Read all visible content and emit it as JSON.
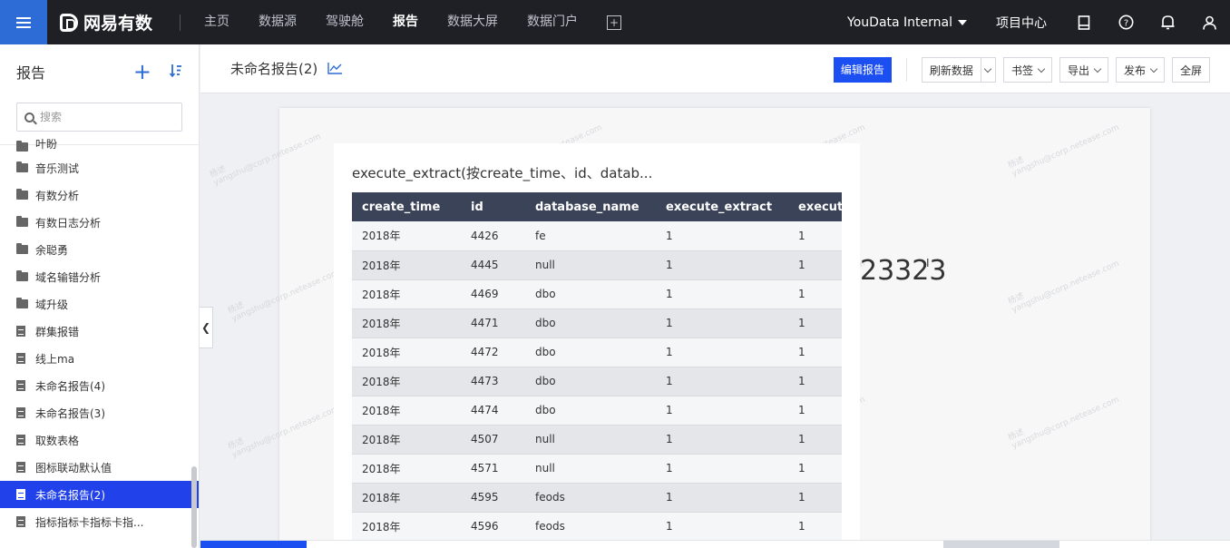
{
  "app": {
    "logo_text": "网易有数",
    "nav": [
      "主页",
      "数据源",
      "驾驶舱",
      "报告",
      "数据大屏",
      "数据门户"
    ],
    "active_nav_index": 3,
    "org": "YouData Internal",
    "project_center": "项目中心"
  },
  "sidebar": {
    "title": "报告",
    "search_placeholder": "搜索",
    "items": [
      {
        "type": "folder",
        "label": "叶盼"
      },
      {
        "type": "folder",
        "label": "音乐测试"
      },
      {
        "type": "folder",
        "label": "有数分析"
      },
      {
        "type": "folder",
        "label": "有数日志分析"
      },
      {
        "type": "folder",
        "label": "余聪勇"
      },
      {
        "type": "folder",
        "label": "域名输错分析"
      },
      {
        "type": "folder",
        "label": "域升级"
      },
      {
        "type": "report",
        "label": "群集报错"
      },
      {
        "type": "report",
        "label": "线上ma"
      },
      {
        "type": "report",
        "label": "未命名报告(4)"
      },
      {
        "type": "report",
        "label": "未命名报告(3)"
      },
      {
        "type": "report",
        "label": "取数表格"
      },
      {
        "type": "report",
        "label": "图标联动默认值"
      },
      {
        "type": "report",
        "label": "未命名报告(2)",
        "active": true
      },
      {
        "type": "report",
        "label": "指标指标卡指标卡指..."
      }
    ]
  },
  "toolbar": {
    "report_title": "未命名报告(2)",
    "edit_label": "编辑报告",
    "refresh_label": "刷新数据",
    "bookmark_label": "书签",
    "export_label": "导出",
    "publish_label": "发布",
    "fullscreen_label": "全屏"
  },
  "card": {
    "title": "execute_extract(按create_time、id、datab...",
    "columns": [
      "create_time",
      "id",
      "database_name",
      "execute_extract",
      "execute"
    ],
    "rows": [
      [
        "2018年",
        "4426",
        "fe",
        "1",
        "1"
      ],
      [
        "2018年",
        "4445",
        "null",
        "1",
        "1"
      ],
      [
        "2018年",
        "4469",
        "dbo",
        "1",
        "1"
      ],
      [
        "2018年",
        "4471",
        "dbo",
        "1",
        "1"
      ],
      [
        "2018年",
        "4472",
        "dbo",
        "1",
        "1"
      ],
      [
        "2018年",
        "4473",
        "dbo",
        "1",
        "1"
      ],
      [
        "2018年",
        "4474",
        "dbo",
        "1",
        "1"
      ],
      [
        "2018年",
        "4507",
        "null",
        "1",
        "1"
      ],
      [
        "2018年",
        "4571",
        "null",
        "1",
        "1"
      ],
      [
        "2018年",
        "4595",
        "feods",
        "1",
        "1"
      ],
      [
        "2018年",
        "4596",
        "feods",
        "1",
        "1"
      ]
    ]
  },
  "big_number": "23323",
  "watermark": {
    "line1": "杨述",
    "line2": "yangshu@corp.netease.com"
  },
  "colors": {
    "topbar": "#1f2026",
    "accent": "#2d6bd6",
    "primary_button": "#1c4ff2",
    "active_item": "#2142ea",
    "table_header": "#3b4359"
  }
}
